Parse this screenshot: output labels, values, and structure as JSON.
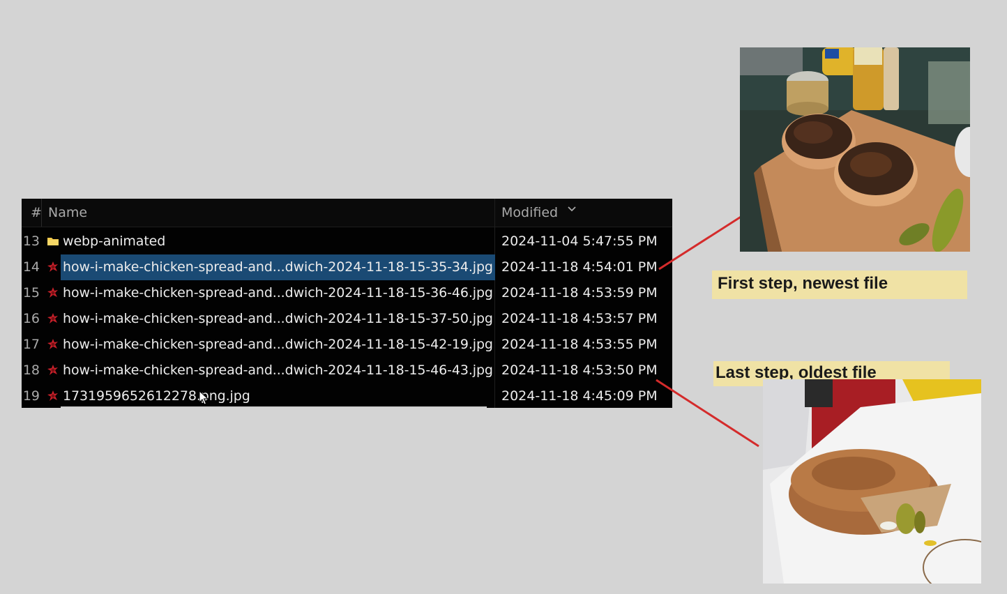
{
  "file_list": {
    "columns": {
      "number": "#",
      "name": "Name",
      "modified": "Modified"
    },
    "sort_icon": "chevron-down-icon",
    "rows": [
      {
        "num": "13",
        "icon": "folder-icon",
        "name": "webp-animated",
        "modified": "2024-11-04 5:47:55 PM",
        "selected": false
      },
      {
        "num": "14",
        "icon": "image-file-icon",
        "name": "how-i-make-chicken-spread-and...dwich-2024-11-18-15-35-34.jpg",
        "modified": "2024-11-18 4:54:01 PM",
        "selected": true
      },
      {
        "num": "15",
        "icon": "image-file-icon",
        "name": "how-i-make-chicken-spread-and...dwich-2024-11-18-15-36-46.jpg",
        "modified": "2024-11-18 4:53:59 PM",
        "selected": false
      },
      {
        "num": "16",
        "icon": "image-file-icon",
        "name": "how-i-make-chicken-spread-and...dwich-2024-11-18-15-37-50.jpg",
        "modified": "2024-11-18 4:53:57 PM",
        "selected": false
      },
      {
        "num": "17",
        "icon": "image-file-icon",
        "name": "how-i-make-chicken-spread-and...dwich-2024-11-18-15-42-19.jpg",
        "modified": "2024-11-18 4:53:55 PM",
        "selected": false
      },
      {
        "num": "18",
        "icon": "image-file-icon",
        "name": "how-i-make-chicken-spread-and...dwich-2024-11-18-15-46-43.jpg",
        "modified": "2024-11-18 4:53:50 PM",
        "selected": false
      },
      {
        "num": "19",
        "icon": "image-file-icon",
        "name": "1731959652612278.png.jpg",
        "modified": "2024-11-18 4:45:09 PM",
        "selected": false
      }
    ]
  },
  "annotations": {
    "first_label": "First step, newest file",
    "last_label": "Last step, oldest file",
    "arrow_color": "#d42b2b",
    "highlight_color": "#f0e2a5"
  },
  "colors": {
    "selection": "#1a4a74",
    "folder": "#f2c94c",
    "file_icon": "#c8202a"
  }
}
